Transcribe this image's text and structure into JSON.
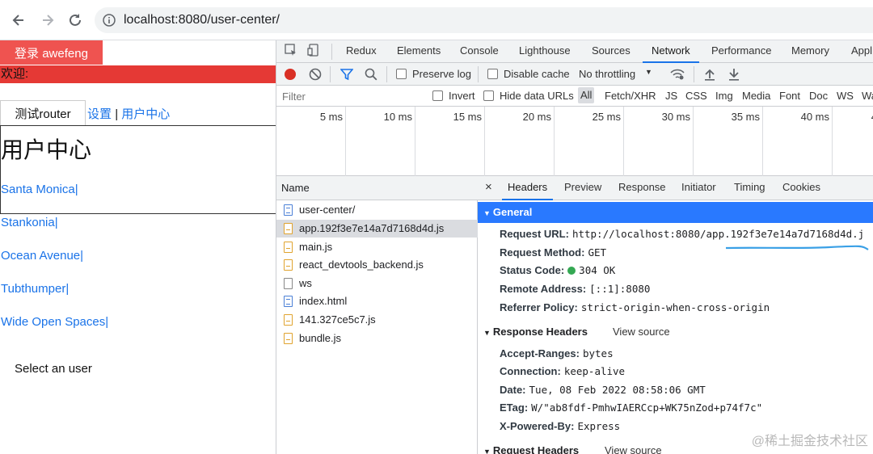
{
  "browser": {
    "url": "localhost:8080/user-center/"
  },
  "page": {
    "login_button": "登录 awefeng",
    "welcome": "欢迎:",
    "router_button": "测试router",
    "nav_settings": "设置",
    "nav_separator": "|",
    "nav_user_center": "用户中心",
    "title": "用户中心",
    "users": [
      "Santa Monica|",
      "Stankonia|",
      "Ocean Avenue|",
      "Tubthumper|",
      "Wide Open Spaces|"
    ],
    "select_user": "Select an user"
  },
  "devtools": {
    "tabs": [
      "Redux",
      "Elements",
      "Console",
      "Lighthouse",
      "Sources",
      "Network",
      "Performance",
      "Memory",
      "Appl"
    ],
    "active_tab": "Network",
    "toolbar": {
      "preserve_log": "Preserve log",
      "disable_cache": "Disable cache",
      "throttling": "No throttling"
    },
    "filter": {
      "placeholder": "Filter",
      "invert": "Invert",
      "hide_data_urls": "Hide data URLs",
      "types": [
        "All",
        "Fetch/XHR",
        "JS",
        "CSS",
        "Img",
        "Media",
        "Font",
        "Doc",
        "WS",
        "Wa"
      ]
    },
    "timeline_ticks": [
      "5 ms",
      "10 ms",
      "15 ms",
      "20 ms",
      "25 ms",
      "30 ms",
      "35 ms",
      "40 ms",
      "4"
    ],
    "request_list": {
      "header": "Name",
      "items": [
        {
          "name": "user-center/",
          "type": "doc"
        },
        {
          "name": "app.192f3e7e14a7d7168d4d.js",
          "type": "js"
        },
        {
          "name": "main.js",
          "type": "js"
        },
        {
          "name": "react_devtools_backend.js",
          "type": "js"
        },
        {
          "name": "ws",
          "type": "ws"
        },
        {
          "name": "index.html",
          "type": "doc"
        },
        {
          "name": "141.327ce5c7.js",
          "type": "js"
        },
        {
          "name": "bundle.js",
          "type": "js"
        }
      ],
      "selected_index": 1
    },
    "detail_tabs": [
      "Headers",
      "Preview",
      "Response",
      "Initiator",
      "Timing",
      "Cookies"
    ],
    "close_symbol": "×",
    "general": {
      "title": "General",
      "fields": [
        {
          "key": "Request URL:",
          "value": "http://localhost:8080/app.192f3e7e14a7d7168d4d.j"
        },
        {
          "key": "Request Method:",
          "value": "GET"
        },
        {
          "key": "Status Code:",
          "value": "304 OK"
        },
        {
          "key": "Remote Address:",
          "value": "[::1]:8080"
        },
        {
          "key": "Referrer Policy:",
          "value": "strict-origin-when-cross-origin"
        }
      ]
    },
    "response_headers": {
      "title": "Response Headers",
      "view_source": "View source",
      "fields": [
        {
          "key": "Accept-Ranges:",
          "value": "bytes"
        },
        {
          "key": "Connection:",
          "value": "keep-alive"
        },
        {
          "key": "Date:",
          "value": "Tue, 08 Feb 2022 08:58:06 GMT"
        },
        {
          "key": "ETag:",
          "value": "W/\"ab8fdf-PmhwIAERCcp+WK75nZod+p74f7c\""
        },
        {
          "key": "X-Powered-By:",
          "value": "Express"
        }
      ]
    },
    "request_headers": {
      "title": "Request Headers",
      "view_source": "View source"
    }
  },
  "watermark": "@稀土掘金技术社区",
  "colors": {
    "login_button": "#ef5350",
    "welcome_bar": "#e53935",
    "link": "#1a73e8",
    "general_header": "#2979ff",
    "status_ok": "#34a853"
  }
}
